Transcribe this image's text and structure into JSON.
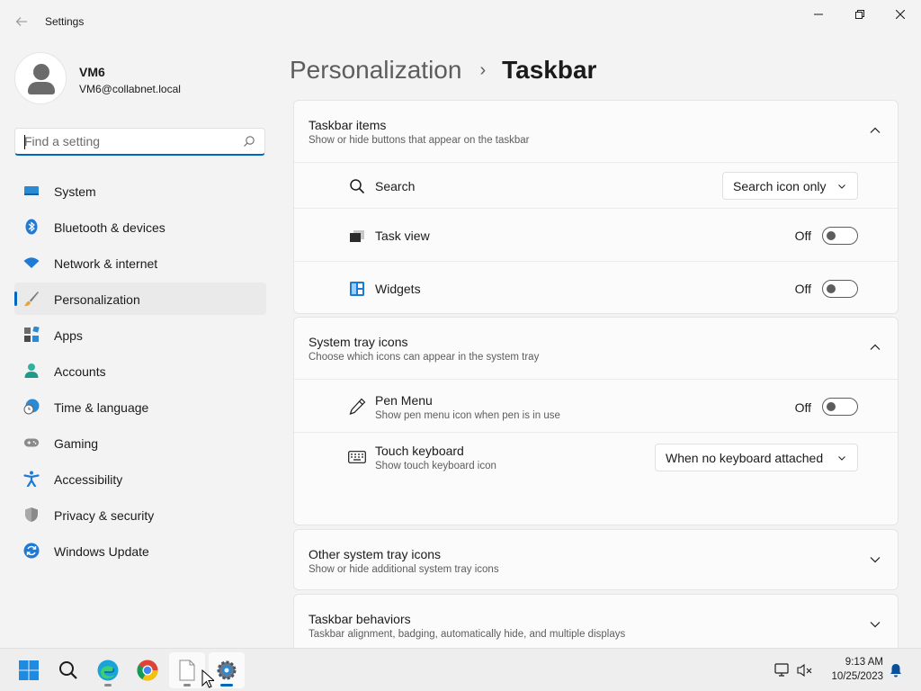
{
  "window": {
    "title": "Settings",
    "minimize": "—",
    "maximize": "❐",
    "close": "✕"
  },
  "user": {
    "name": "VM6",
    "email": "VM6@collabnet.local"
  },
  "search": {
    "placeholder": "Find a setting"
  },
  "nav": {
    "items": [
      {
        "label": "System",
        "icon": "system-icon"
      },
      {
        "label": "Bluetooth & devices",
        "icon": "bluetooth-icon"
      },
      {
        "label": "Network & internet",
        "icon": "wifi-icon"
      },
      {
        "label": "Personalization",
        "icon": "brush-icon",
        "selected": true
      },
      {
        "label": "Apps",
        "icon": "apps-icon"
      },
      {
        "label": "Accounts",
        "icon": "accounts-icon"
      },
      {
        "label": "Time & language",
        "icon": "time-language-icon"
      },
      {
        "label": "Gaming",
        "icon": "gamepad-icon"
      },
      {
        "label": "Accessibility",
        "icon": "accessibility-icon"
      },
      {
        "label": "Privacy & security",
        "icon": "shield-icon"
      },
      {
        "label": "Windows Update",
        "icon": "update-icon"
      }
    ]
  },
  "breadcrumb": {
    "parent": "Personalization",
    "separator": "›",
    "current": "Taskbar"
  },
  "sections": {
    "taskbar_items": {
      "title": "Taskbar items",
      "description": "Show or hide buttons that appear on the taskbar",
      "search": {
        "label": "Search",
        "value": "Search icon only"
      },
      "task_view": {
        "label": "Task view",
        "state": "Off"
      },
      "widgets": {
        "label": "Widgets",
        "state": "Off"
      }
    },
    "system_tray_icons": {
      "title": "System tray icons",
      "description": "Choose which icons can appear in the system tray",
      "pen_menu": {
        "label": "Pen Menu",
        "description": "Show pen menu icon when pen is in use",
        "state": "Off"
      },
      "touch_keyboard": {
        "label": "Touch keyboard",
        "description": "Show touch keyboard icon",
        "value": "When no keyboard attached"
      }
    },
    "other_tray_icons": {
      "title": "Other system tray icons",
      "description": "Show or hide additional system tray icons"
    },
    "taskbar_behaviors": {
      "title": "Taskbar behaviors",
      "description": "Taskbar alignment, badging, automatically hide, and multiple displays"
    }
  },
  "taskbar": {
    "apps": [
      "start-icon",
      "search-icon",
      "edge-icon",
      "chrome-icon",
      "notepad-icon",
      "settings-icon"
    ],
    "time": "9:13 AM",
    "date": "10/25/2023"
  },
  "colors": {
    "accent": "#0067c0",
    "background": "#f3f3f3",
    "card": "#fbfbfb"
  }
}
